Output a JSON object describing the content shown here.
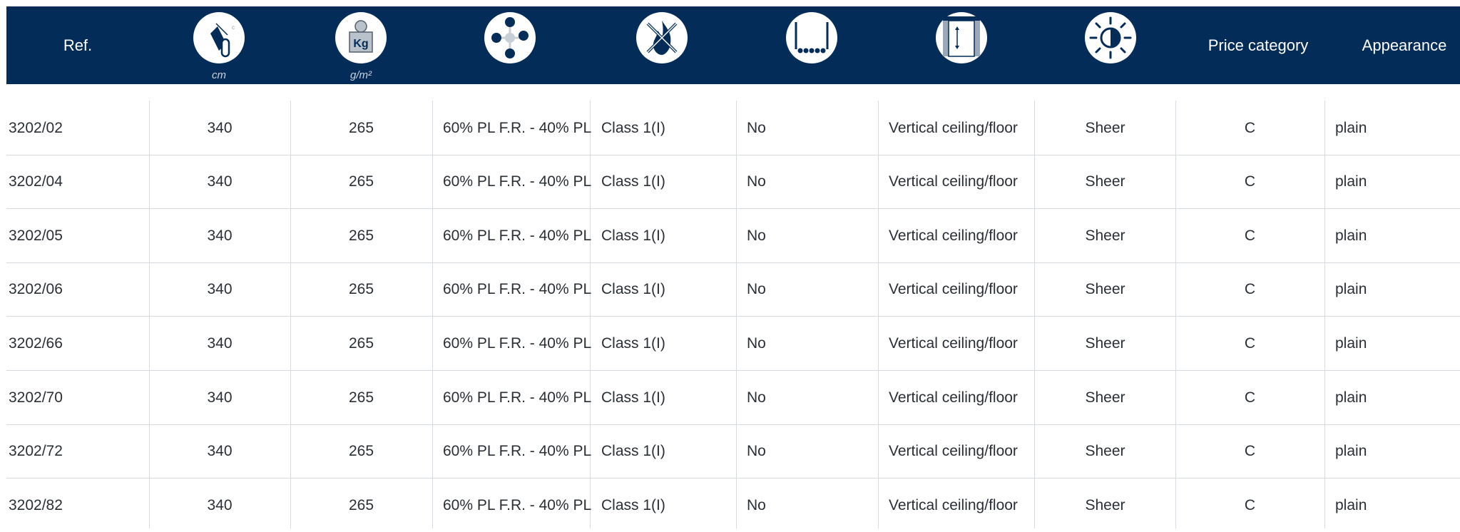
{
  "header": {
    "ref": "Ref.",
    "width_unit": "cm",
    "weight_unit": "g/m²",
    "weight_icon_label": "Kg",
    "price_category": "Price category",
    "appearance": "Appearance"
  },
  "icons": [
    "fabric-width-icon",
    "weight-icon",
    "composition-icon",
    "fire-resistance-icon",
    "lead-weight-icon",
    "orientation-icon",
    "light-transparency-icon"
  ],
  "colors": {
    "header_bg": "#032c59",
    "header_text": "#ffffff",
    "divider": "#d6d9de"
  },
  "rows": [
    [
      "3202/02",
      "340",
      "265",
      "60% PL F.R. - 40% PL",
      "Class 1(I)",
      "No",
      "Vertical ceiling/floor",
      "Sheer",
      "C",
      "plain"
    ],
    [
      "3202/04",
      "340",
      "265",
      "60% PL F.R. - 40% PL",
      "Class 1(I)",
      "No",
      "Vertical ceiling/floor",
      "Sheer",
      "C",
      "plain"
    ],
    [
      "3202/05",
      "340",
      "265",
      "60% PL F.R. - 40% PL",
      "Class 1(I)",
      "No",
      "Vertical ceiling/floor",
      "Sheer",
      "C",
      "plain"
    ],
    [
      "3202/06",
      "340",
      "265",
      "60% PL F.R. - 40% PL",
      "Class 1(I)",
      "No",
      "Vertical ceiling/floor",
      "Sheer",
      "C",
      "plain"
    ],
    [
      "3202/66",
      "340",
      "265",
      "60% PL F.R. - 40% PL",
      "Class 1(I)",
      "No",
      "Vertical ceiling/floor",
      "Sheer",
      "C",
      "plain"
    ],
    [
      "3202/70",
      "340",
      "265",
      "60% PL F.R. - 40% PL",
      "Class 1(I)",
      "No",
      "Vertical ceiling/floor",
      "Sheer",
      "C",
      "plain"
    ],
    [
      "3202/72",
      "340",
      "265",
      "60% PL F.R. - 40% PL",
      "Class 1(I)",
      "No",
      "Vertical ceiling/floor",
      "Sheer",
      "C",
      "plain"
    ],
    [
      "3202/82",
      "340",
      "265",
      "60% PL F.R. - 40% PL",
      "Class 1(I)",
      "No",
      "Vertical ceiling/floor",
      "Sheer",
      "C",
      "plain"
    ]
  ]
}
